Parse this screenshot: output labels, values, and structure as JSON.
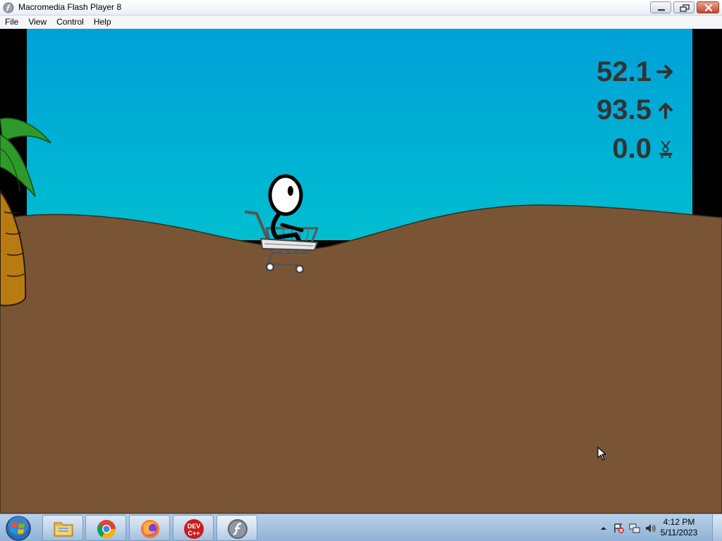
{
  "window": {
    "title": "Macromedia Flash Player 8",
    "app_icon": "flash-player-icon",
    "controls": [
      "minimize-icon",
      "restore-icon",
      "close-icon"
    ]
  },
  "menubar": {
    "items": [
      "File",
      "View",
      "Control",
      "Help"
    ]
  },
  "game": {
    "hud": {
      "horizontal_distance": "52.1",
      "horizontal_icon": "arrow-right-icon",
      "height": "93.5",
      "height_icon": "arrow-up-icon",
      "third_value": "0.0",
      "third_icon": "stickman-cart-icon"
    },
    "colors": {
      "sky_top": "#00a0d8",
      "sky_bottom": "#00bcd0",
      "ground": "#7a5535",
      "hud_text": "#333333"
    }
  },
  "taskbar": {
    "start_icon": "windows-start-icon",
    "pinned": [
      {
        "name": "file-explorer-icon"
      },
      {
        "name": "chrome-icon"
      },
      {
        "name": "firefox-icon"
      },
      {
        "name": "dev-cpp-icon",
        "label": "DEV C++"
      },
      {
        "name": "flash-player-icon",
        "active": true
      }
    ],
    "tray_icons": [
      "show-hidden-icons-icon",
      "action-center-icon",
      "network-icon",
      "volume-icon"
    ],
    "clock": {
      "time": "4:12 PM",
      "date": "5/11/2023"
    }
  }
}
